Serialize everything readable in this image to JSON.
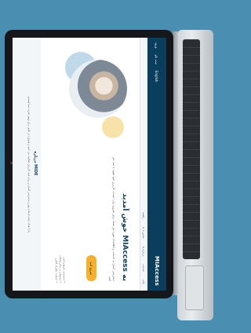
{
  "header": {
    "logo": "MIAccess",
    "links": [
      "ورود",
      "ثبت نام",
      "English"
    ]
  },
  "nav": {
    "items": [
      "خانه",
      "خدمات",
      "درباره ما",
      "تماس با ما",
      "راهنما"
    ]
  },
  "hero": {
    "title": "به MIAccess خوش آمدید",
    "body": "دسترسی آسان به خدمات و اطلاعات مورد نیاز شما. برای شروع، وارد حساب کاربری خود شوید یا ثبت نام کنید.",
    "button": "شروع کنید"
  },
  "bullets": [
    "دسترسی سریع و ایمن",
    "پشتیبانی در تمام ساعات",
    "خدمات یکپارچه آنلاین"
  ],
  "about": {
    "title": "درباره MIDE",
    "text": "ما با هدف ارائه خدمات بهتر و دسترسی آسان تر برای همه کاربران فعالیت می کنیم و همواره در تلاش برای بهبود تجربه شما هستیم."
  },
  "colors": {
    "background": "#4a8fb1",
    "brand": "#0b3d5c",
    "accent": "#f5b02e"
  }
}
